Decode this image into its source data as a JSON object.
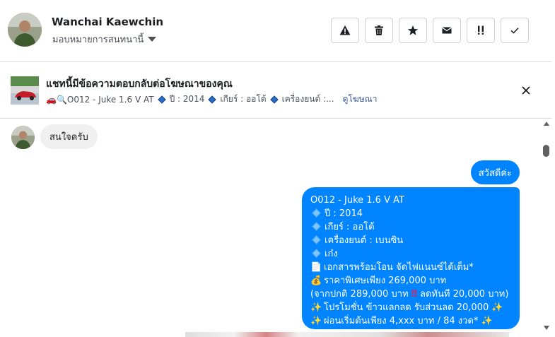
{
  "header": {
    "name": "Wanchai Kaewchin",
    "assign_label": "มอบหมายการสนทนานี้",
    "actions": [
      "spam-warning-icon",
      "trash-icon",
      "star-icon",
      "envelope-icon",
      "double-exclamation-icon",
      "check-icon"
    ]
  },
  "banner": {
    "title": "แชทนี้มีข้อความตอบกลับต่อโฆษณาของคุณ",
    "sub_prefix": "🚗🔍O012 - Juke 1.6 V AT",
    "sub_year": "ปี : 2014",
    "sub_gear": "เกียร์ : ออโต้",
    "sub_engine": "เครื่องยนต์ :...",
    "link": "ดูโฆษณา"
  },
  "messages": {
    "incoming_1": "สนใจครับ",
    "outgoing_1": "สวัสดีค่ะ",
    "outgoing_2": {
      "line1": "O012 - Juke 1.6 V AT",
      "line2": "ปี : 2014",
      "line3": "เกียร์ : ออโต้",
      "line4": "เครื่องยนต์ : เบนซิน",
      "line5": "เก๋ง",
      "line6": "เอกสารพร้อมโอน จัดไฟแนนซ์ได้เต็ม*",
      "line7": "ราคาพิเศษเพียง 269,000 บาท",
      "line8a": "(จากปกติ 289,000 บาท",
      "line8b": "ลดทันที 20,000 บาท)",
      "line9": "โปรโมชั่น ข้าวแลกลด รับส่วนลด 20,000",
      "line10": "ผ่อนเริ่มต้นเพียง 4,xxx บาท / 84 งวด*"
    }
  },
  "colors": {
    "accent_blue": "#0084ff",
    "link_blue": "#385898",
    "incoming_bubble": "#f1f0f0"
  }
}
